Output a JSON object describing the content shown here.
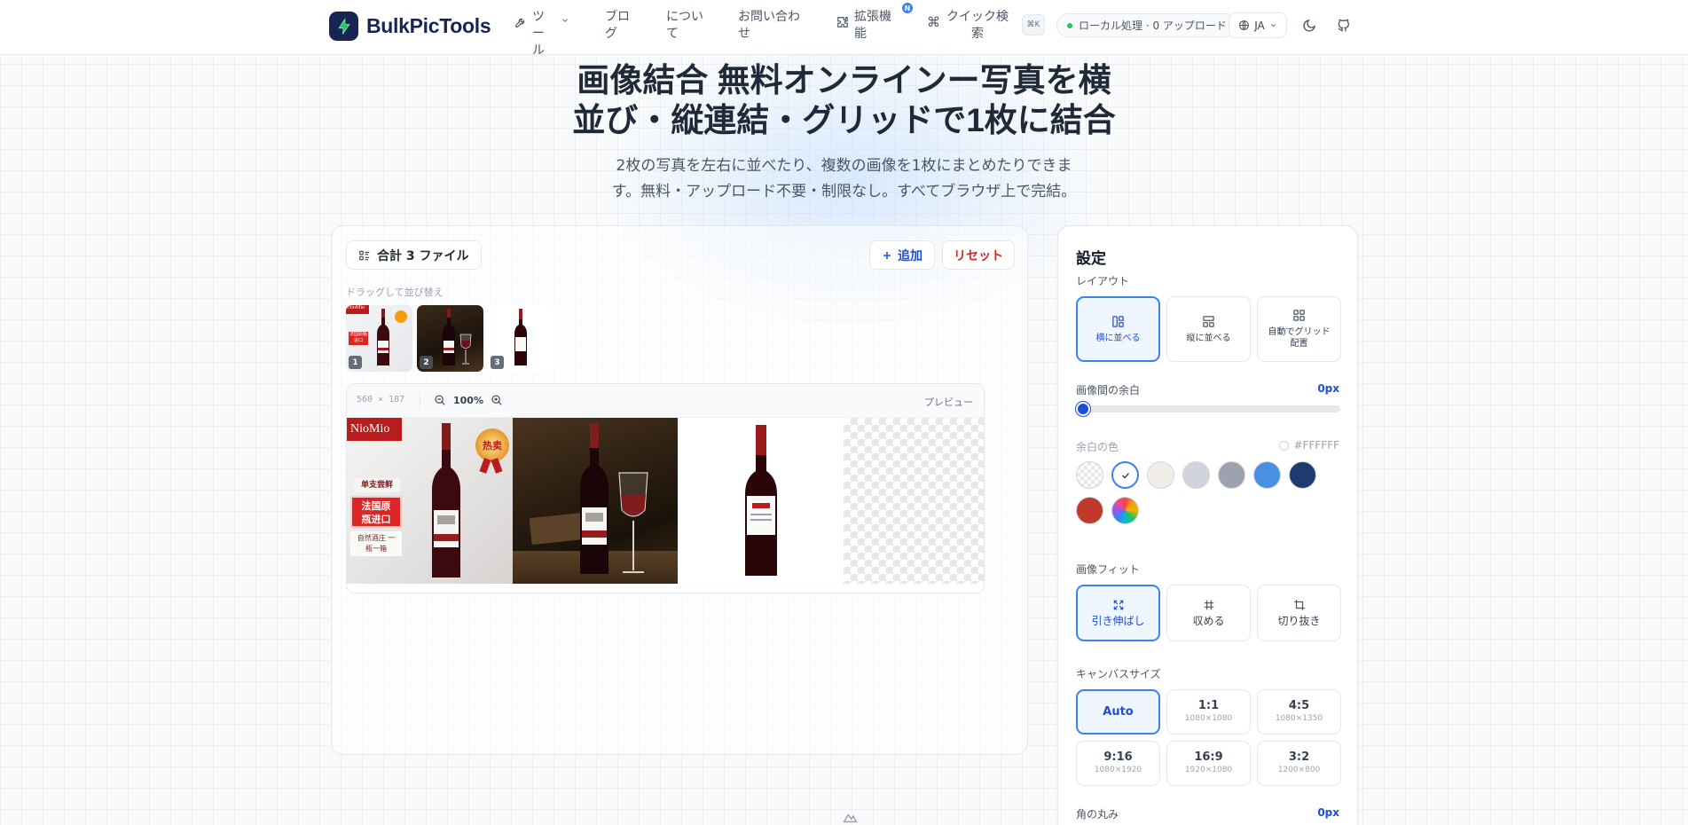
{
  "header": {
    "brand": "BulkPicTools",
    "nav": {
      "tools": "ツール",
      "blog": "ブログ",
      "about": "について",
      "contact": "お問い合わせ",
      "extensions": "拡張機能",
      "extensions_badge": "N",
      "quick_search": "クイック検索",
      "quick_search_kbd": "⌘K"
    },
    "status": "ローカル処理 · 0 アップロード",
    "language": "JA"
  },
  "hero": {
    "title_line1": "画像結合 無料オンラインー写真を横",
    "title_line2": "並び・縦連結・グリッドで1枚に結合",
    "subtitle_line1": "2枚の写真を左右に並べたり、複数の画像を1枚にまとめたりできま",
    "subtitle_line2": "す。無料・アップロード不要・制限なし。すべてブラウザ上で完結。"
  },
  "files": {
    "count_label": "合計 3 ファイル",
    "add_label": "追加",
    "reset_label": "リセット",
    "drag_hint": "ドラッグして並び替え",
    "thumbnails": [
      {
        "num": "1",
        "brand_text": "NioMio",
        "banner": "法国原瓶进口"
      },
      {
        "num": "2"
      },
      {
        "num": "3"
      }
    ]
  },
  "preview": {
    "dimensions": "560 × 187",
    "zoom": "100%",
    "label": "プレビュー",
    "image1": {
      "brand_text": "NioMio",
      "medal": "热卖",
      "tag1": "单支尝鲜",
      "banner": "法国原瓶进口",
      "tag2": "自然酒庄 一瓶一箱"
    }
  },
  "settings": {
    "title": "設定",
    "layout": {
      "label": "レイアウト",
      "options": [
        "横に並べる",
        "縦に並べる",
        "自動でグリッド配置"
      ],
      "selected": "横に並べる"
    },
    "spacing": {
      "label": "画像間の余白",
      "value": "0px",
      "level": 0
    },
    "bg_color": {
      "label": "余白の色",
      "value": "#FFFFFF",
      "swatches": [
        "transparent",
        "#FFFFFF",
        "#F1EEE8",
        "#D1D5DB",
        "#9CA3AF",
        "#4A90E2",
        "#1E3A6E",
        "#C0392B",
        "custom"
      ]
    },
    "fit": {
      "label": "画像フィット",
      "options": [
        "引き伸ばし",
        "収める",
        "切り抜き"
      ],
      "selected": "引き伸ばし"
    },
    "canvas": {
      "label": "キャンバスサイズ",
      "options": [
        {
          "name": "Auto",
          "size": ""
        },
        {
          "name": "1:1",
          "size": "1080×1080"
        },
        {
          "name": "4:5",
          "size": "1080×1350"
        },
        {
          "name": "9:16",
          "size": "1080×1920"
        },
        {
          "name": "16:9",
          "size": "1920×1080"
        },
        {
          "name": "3:2",
          "size": "1200×800"
        }
      ],
      "selected": "Auto"
    },
    "radius": {
      "label": "角の丸み",
      "value": "0px"
    }
  },
  "colors": {
    "accent": "#3B82F6",
    "brand": "#172554",
    "danger": "#DC2626"
  }
}
